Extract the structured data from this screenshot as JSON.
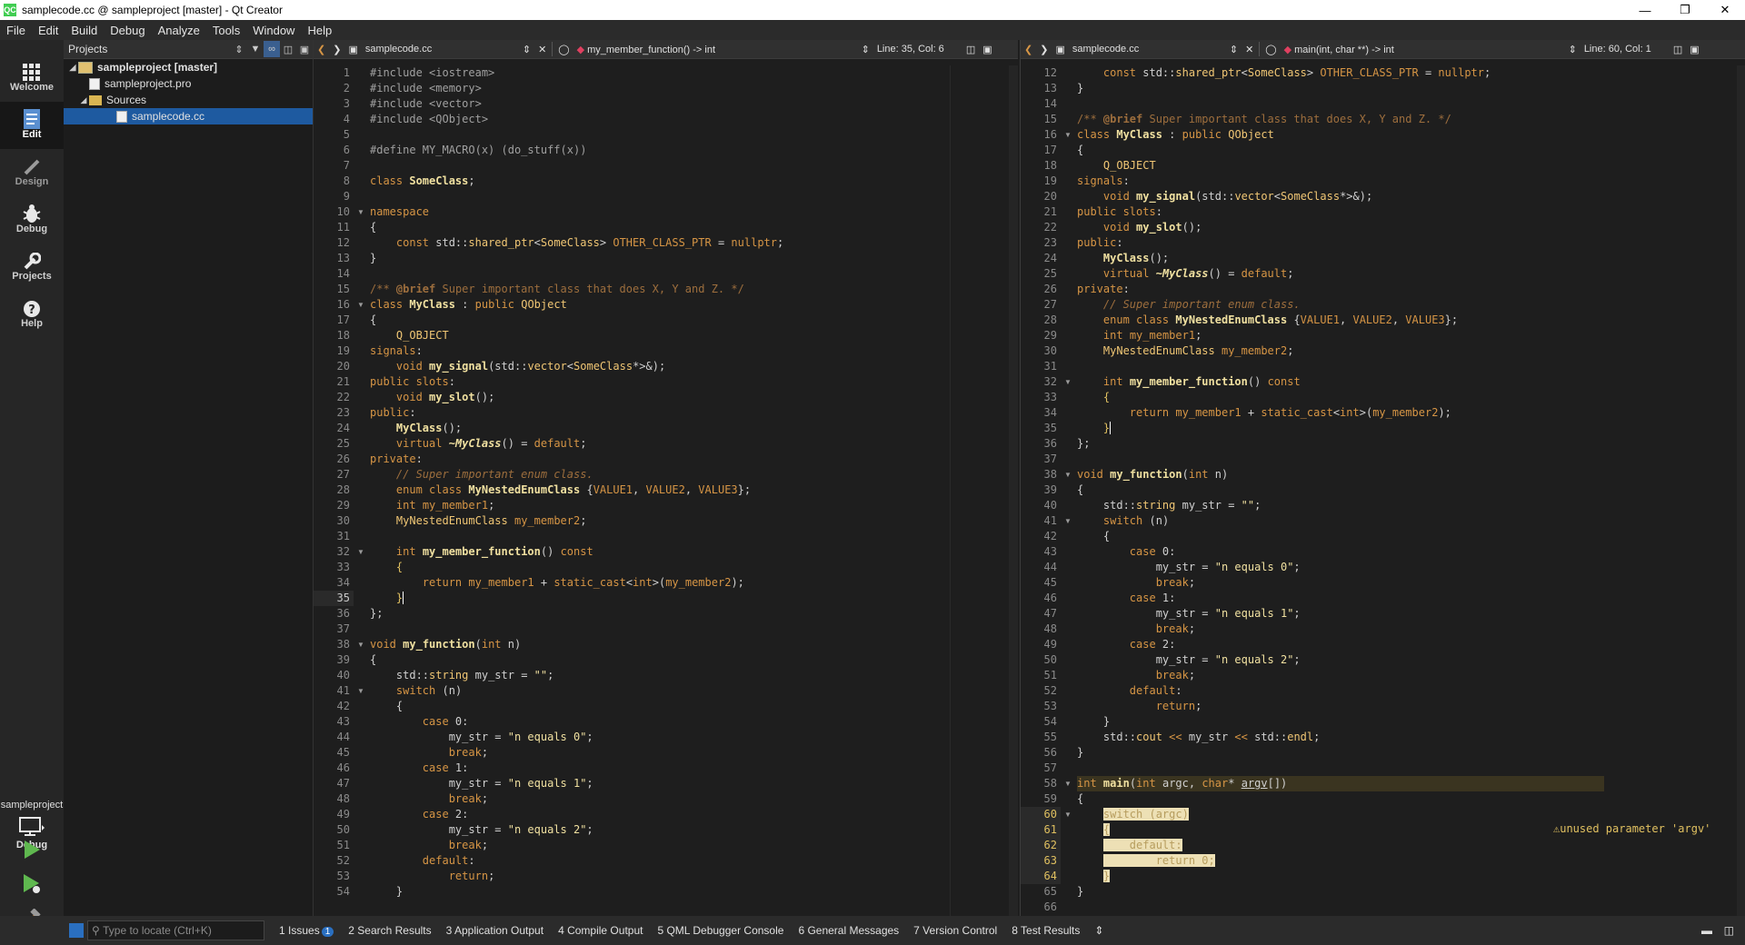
{
  "window": {
    "title": "samplecode.cc @ sampleproject [master] - Qt Creator",
    "app_icon": "QC"
  },
  "menu": [
    "File",
    "Edit",
    "Build",
    "Debug",
    "Analyze",
    "Tools",
    "Window",
    "Help"
  ],
  "modes": [
    "Welcome",
    "Edit",
    "Design",
    "Debug",
    "Projects",
    "Help"
  ],
  "kit": {
    "project": "sampleproject",
    "mode": "Debug"
  },
  "projects_panel": {
    "title": "Projects",
    "tree": [
      {
        "label": "sampleproject [master]",
        "level": 0,
        "type": "project"
      },
      {
        "label": "sampleproject.pro",
        "level": 1,
        "type": "file"
      },
      {
        "label": "Sources",
        "level": 1,
        "type": "folder"
      },
      {
        "label": "samplecode.cc",
        "level": 2,
        "type": "file",
        "selected": true
      }
    ]
  },
  "editor_left": {
    "file": "samplecode.cc",
    "symbol": "my_member_function() -> int",
    "position": "Line: 35, Col: 6",
    "first_line": 1,
    "current_line": 35
  },
  "editor_right": {
    "file": "samplecode.cc",
    "symbol": "main(int, char **) -> int",
    "position": "Line: 60, Col: 1",
    "first_line": 12,
    "warning_text": "unused parameter 'argv'"
  },
  "status": {
    "locate_placeholder": "Type to locate (Ctrl+K)",
    "tabs": [
      "1  Issues",
      "2  Search Results",
      "3  Application Output",
      "4  Compile Output",
      "5  QML Debugger Console",
      "6  General Messages",
      "7  Version Control",
      "8  Test Results"
    ],
    "issues_count": "1"
  },
  "colors": {
    "keyword": "#d69545",
    "type": "#f0c674",
    "comment": "#9d6e3d",
    "selection": "#1e5aa0"
  }
}
